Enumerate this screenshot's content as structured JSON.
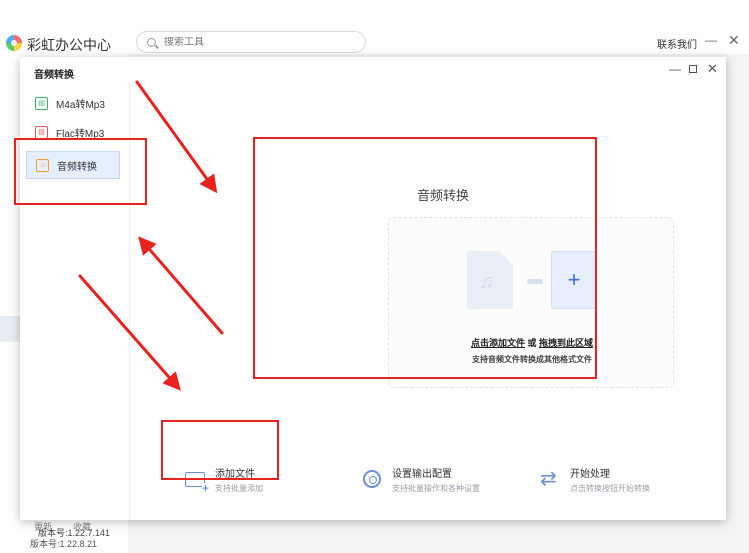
{
  "app": {
    "title": "彩虹办公中心",
    "search_placeholder": "搜索工具",
    "contact": "联系我们",
    "minimize": "—",
    "close": "✕",
    "left_update": "更新",
    "left_favorites": "收藏",
    "left_version": "版本号:1.22.8.21"
  },
  "dialog": {
    "title": "音频转换",
    "minimize": "—",
    "close": "✕",
    "sidebar": [
      {
        "label": "M4a转Mp3",
        "icon": "m4a-icon"
      },
      {
        "label": "Flac转Mp3",
        "icon": "flac-icon"
      },
      {
        "label": "音频转换",
        "icon": "music-note-icon",
        "selected": true
      }
    ],
    "version": "版本号:1.22.7.141",
    "main": {
      "heading": "音频转换",
      "drop_text_add": "点击添加文件",
      "drop_text_or": " 或 ",
      "drop_text_drag": "拖拽到此区域",
      "drop_sub": "支持音频文件转换成其他格式文件",
      "plus": "+"
    },
    "actions": [
      {
        "title": "添加文件",
        "subtitle": "支持批量添加",
        "icon": "add-folder-icon"
      },
      {
        "title": "设置输出配置",
        "subtitle": "支持批量操作和各种设置",
        "icon": "settings-icon"
      },
      {
        "title": "开始处理",
        "subtitle": "点击转换按钮开始转换",
        "icon": "convert-icon"
      }
    ]
  },
  "annotations": {
    "color": "#e8231f"
  }
}
